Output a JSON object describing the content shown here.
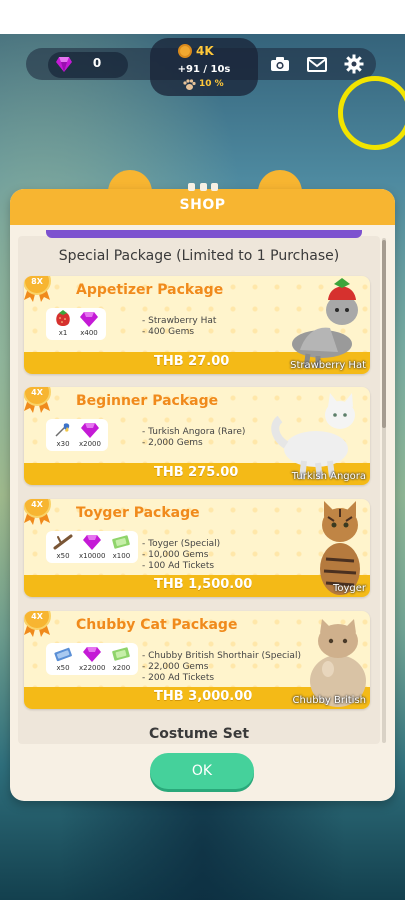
{
  "hud": {
    "gems": "0",
    "coins": "4K",
    "rate": "+91 / 10s",
    "bonus": "10 %"
  },
  "shop": {
    "title": "SHOP",
    "section_title": "Special Package (Limited to 1 Purchase)",
    "costume_title": "Costume Set",
    "ok_label": "OK"
  },
  "packages": [
    {
      "name": "Appetizer Package",
      "badge": "8X",
      "price": "THB 27.00",
      "cat": "Strawberry Hat",
      "items": [
        {
          "icon": "strawberry-hat-icon",
          "qty": "x1"
        },
        {
          "icon": "gem-icon",
          "qty": "x400"
        }
      ],
      "desc": [
        "- Strawberry Hat",
        "- 400 Gems"
      ]
    },
    {
      "name": "Beginner Package",
      "badge": "4X",
      "price": "THB 275.00",
      "cat": "Turkish Angora",
      "items": [
        {
          "icon": "cat-toy-icon",
          "qty": "x30"
        },
        {
          "icon": "gem-icon",
          "qty": "x2000"
        }
      ],
      "desc": [
        "- Turkish Angora (Rare)",
        "- 2,000 Gems"
      ]
    },
    {
      "name": "Toyger Package",
      "badge": "4X",
      "price": "THB 1,500.00",
      "cat": "Toyger",
      "items": [
        {
          "icon": "stick-icon",
          "qty": "x50"
        },
        {
          "icon": "gem-icon",
          "qty": "x10000"
        },
        {
          "icon": "ad-ticket-icon",
          "qty": "x100"
        }
      ],
      "desc": [
        "- Toyger (Special)",
        "- 10,000 Gems",
        "- 100 Ad Tickets"
      ]
    },
    {
      "name": "Chubby Cat Package",
      "badge": "4X",
      "price": "THB 3,000.00",
      "cat": "Chubby British",
      "items": [
        {
          "icon": "ticket-icon",
          "qty": "x50"
        },
        {
          "icon": "gem-icon",
          "qty": "x22000"
        },
        {
          "icon": "ad-ticket-icon",
          "qty": "x200"
        }
      ],
      "desc": [
        "- Chubby British Shorthair (Special)",
        "- 22,000 Gems",
        "- 200 Ad Tickets"
      ]
    }
  ],
  "colors": {
    "accent": "#f7b531",
    "ok": "#45d19b",
    "gem": "#c41ad6",
    "title_orange": "#f08a1c"
  }
}
